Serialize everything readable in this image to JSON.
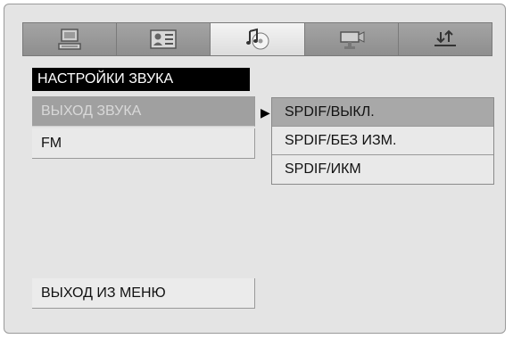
{
  "tabs": [
    {
      "icon": "computer-icon",
      "active": false
    },
    {
      "icon": "id-card-icon",
      "active": false
    },
    {
      "icon": "music-note-disc-icon",
      "active": true
    },
    {
      "icon": "camcorder-icon",
      "active": false
    },
    {
      "icon": "up-down-arrows-icon",
      "active": false
    }
  ],
  "menu": {
    "title": "НАСТРОЙКИ ЗВУКА",
    "items": [
      {
        "label": "ВЫХОД ЗВУКА",
        "selected": true
      },
      {
        "label": "FM",
        "selected": false
      }
    ],
    "exit_label": "ВЫХОД ИЗ МЕНЮ"
  },
  "submenu": {
    "pointer": "▶",
    "options": [
      {
        "label": "SPDIF/ВЫКЛ.",
        "selected": true
      },
      {
        "label": "SPDIF/БЕЗ ИЗМ.",
        "selected": false
      },
      {
        "label": "SPDIF/ИКМ",
        "selected": false
      }
    ]
  },
  "colors": {
    "background": "#e4e4e4",
    "title_bg": "#000000",
    "selected_item": "#a0a0a0"
  }
}
